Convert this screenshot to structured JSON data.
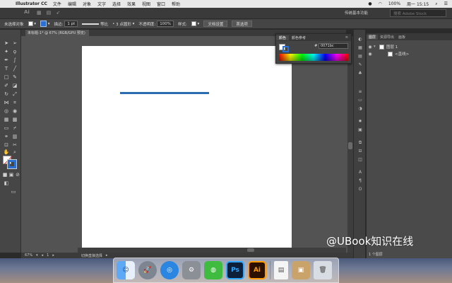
{
  "menubar": {
    "app_name": "Illustrator CC",
    "items": [
      "文件",
      "编辑",
      "对象",
      "文字",
      "选择",
      "效果",
      "视图",
      "窗口",
      "帮助"
    ],
    "battery": "100%",
    "datetime": "周一 15:15"
  },
  "appbar": {
    "logo": "Ai",
    "workspace": "传统基本功能",
    "search_placeholder": "搜索 Adobe Stock"
  },
  "controlbar": {
    "selection_label": "未选择对象",
    "stroke_label": "描边:",
    "stroke_weight": "1 pt",
    "stroke_profile": "等比",
    "brush": "3 点圆形",
    "opacity_label": "不透明度:",
    "opacity_value": "100%",
    "style_label": "样式:",
    "doc_setup": "文档设置",
    "preferences": "首选项"
  },
  "document": {
    "tab_title": "未标题-1* @ 67% (RGB/GPU 预览)"
  },
  "statusbar": {
    "zoom": "67%",
    "artboard_number": "1",
    "tool_hint": "切换直接选择"
  },
  "color_panel": {
    "tab_color": "颜色",
    "tab_guide": "颜色参考",
    "hex_value": "0071bc"
  },
  "layers_panel": {
    "tabs": [
      "图层",
      "资源导出",
      "画板"
    ],
    "layer_name": "图层 1",
    "path_name": "<直线>",
    "layer_count": "1 个图层"
  },
  "colors": {
    "stroke_blue": "#2b6cb0"
  },
  "watermark": "@UBook知识在线",
  "dock": {
    "ps_label": "Ps",
    "ai_label": "Ai"
  }
}
